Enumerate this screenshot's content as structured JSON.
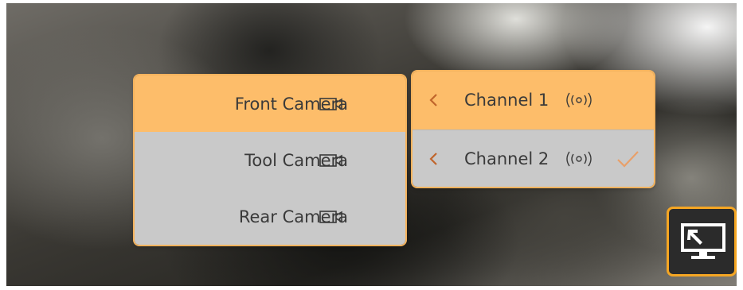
{
  "video": {
    "description_icon": "camera-feed"
  },
  "cameras": [
    {
      "label": "Front Camera",
      "icon": "video-camera-icon",
      "state": "selected"
    },
    {
      "label": "Tool Camera",
      "icon": "video-camera-icon",
      "state": "unselected"
    },
    {
      "label": "Rear Camera",
      "icon": "video-camera-icon",
      "state": "unselected"
    }
  ],
  "channels": [
    {
      "label": "Channel 1",
      "icon": "radio-signal-icon",
      "checked": false,
      "state": "highlighted"
    },
    {
      "label": "Channel 2",
      "icon": "radio-signal-icon",
      "checked": true,
      "state": "unselected"
    }
  ],
  "cast_button": {
    "icon": "screen-cast-icon"
  },
  "colors": {
    "accent": "#fdbd6a",
    "border": "#f4b35e",
    "inactive": "#c9c9c9",
    "cast_border": "#f5a623"
  }
}
